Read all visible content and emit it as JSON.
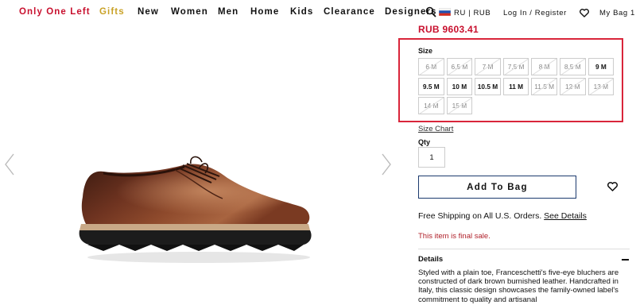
{
  "nav": {
    "items": [
      {
        "label": "Only One Left",
        "style": "red"
      },
      {
        "label": "Gifts",
        "style": "gold"
      },
      {
        "label": "New",
        "style": ""
      },
      {
        "label": "Women",
        "style": ""
      },
      {
        "label": "Men",
        "style": ""
      },
      {
        "label": "Home",
        "style": ""
      },
      {
        "label": "Kids",
        "style": ""
      },
      {
        "label": "Clearance",
        "style": ""
      },
      {
        "label": "Designers",
        "style": ""
      }
    ],
    "locale": "RU | RUB",
    "account": "Log In / Register",
    "bag": "My Bag 1"
  },
  "product": {
    "price": "RUB 9603.41",
    "size_label": "Size",
    "sizes": [
      {
        "label": "6 M",
        "available": false
      },
      {
        "label": "6.5 M",
        "available": false
      },
      {
        "label": "7 M",
        "available": false
      },
      {
        "label": "7.5 M",
        "available": false
      },
      {
        "label": "8 M",
        "available": false
      },
      {
        "label": "8.5 M",
        "available": false
      },
      {
        "label": "9 M",
        "available": true
      },
      {
        "label": "9.5 M",
        "available": true
      },
      {
        "label": "10 M",
        "available": true
      },
      {
        "label": "10.5 M",
        "available": true
      },
      {
        "label": "11 M",
        "available": true
      },
      {
        "label": "11.5 M",
        "available": false
      },
      {
        "label": "12 M",
        "available": false
      },
      {
        "label": "13 M",
        "available": false
      },
      {
        "label": "14 M",
        "available": false
      },
      {
        "label": "15 M",
        "available": false
      }
    ],
    "size_chart": "Size Chart",
    "qty_label": "Qty",
    "qty_value": "1",
    "add_to_bag": "Add To Bag",
    "shipping_text": "Free Shipping on All U.S. Orders.",
    "shipping_link": "See Details",
    "final_sale": "This item is final sale.",
    "details_heading": "Details",
    "details_text": "Styled with a plain toe, Franceschetti's five-eye bluchers are constructed of dark brown burnished leather. Handcrafted in Italy, this classic design showcases the family-owned label's commitment to quality and artisanal"
  },
  "colors": {
    "accent_red": "#c8102e",
    "gold": "#c9a227",
    "highlight_box": "#d9253a",
    "button_border": "#1c3a6e"
  }
}
